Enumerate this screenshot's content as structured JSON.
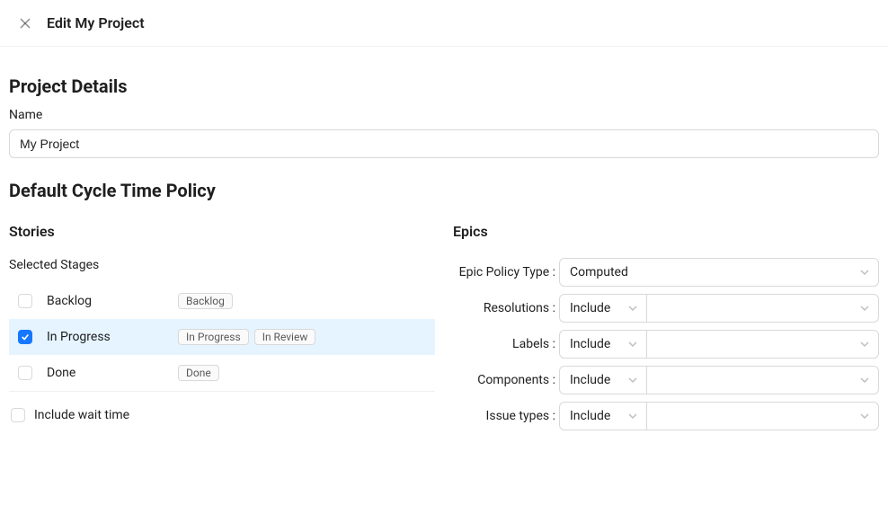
{
  "header": {
    "title": "Edit My Project"
  },
  "sections": {
    "project_details": {
      "title": "Project Details",
      "name_label": "Name",
      "name_value": "My Project"
    },
    "cycle_time": {
      "title": "Default Cycle Time Policy"
    }
  },
  "stories": {
    "title": "Stories",
    "selected_stages_label": "Selected Stages",
    "stages": [
      {
        "name": "Backlog",
        "checked": false,
        "tags": [
          "Backlog"
        ]
      },
      {
        "name": "In Progress",
        "checked": true,
        "tags": [
          "In Progress",
          "In Review"
        ]
      },
      {
        "name": "Done",
        "checked": false,
        "tags": [
          "Done"
        ]
      }
    ],
    "include_wait_time_label": "Include wait time",
    "include_wait_time_checked": false
  },
  "epics": {
    "title": "Epics",
    "policy_type_label": "Epic Policy Type",
    "policy_type_value": "Computed",
    "filters": [
      {
        "label": "Resolutions",
        "mode": "Include",
        "value": ""
      },
      {
        "label": "Labels",
        "mode": "Include",
        "value": ""
      },
      {
        "label": "Components",
        "mode": "Include",
        "value": ""
      },
      {
        "label": "Issue types",
        "mode": "Include",
        "value": ""
      }
    ]
  }
}
